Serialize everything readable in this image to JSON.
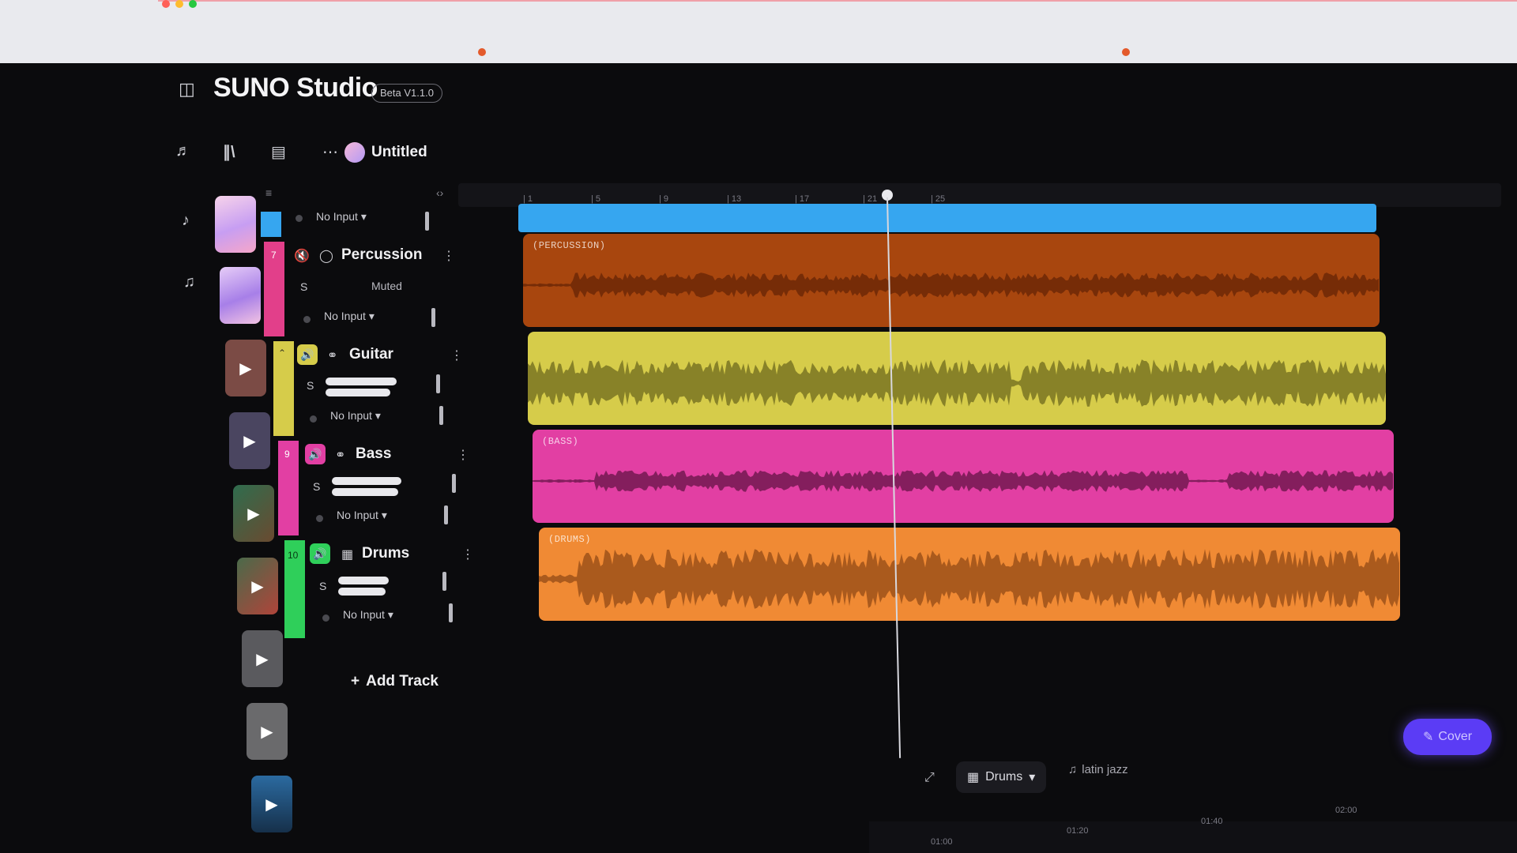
{
  "app": {
    "title": "SUNO Studio",
    "version_badge": "Beta V1.1.0",
    "project_name": "Untitled"
  },
  "colors": {
    "blue_track": "#36a6f0",
    "percussion": "#a8460e",
    "guitar": "#d6cc4a",
    "bass": "#e23fa3",
    "drums": "#f08a34",
    "accent_button": "#5b3cf5"
  },
  "tracks": [
    {
      "label": "",
      "input": "No Input"
    },
    {
      "number": "7",
      "label": "Percussion",
      "solo": "S",
      "status": "Muted",
      "input": "No Input",
      "icon": "percussion-icon"
    },
    {
      "label": "Guitar",
      "solo": "S",
      "input": "No Input",
      "icon": "guitar-icon"
    },
    {
      "number": "9",
      "label": "Bass",
      "solo": "S",
      "input": "No Input",
      "icon": "bass-icon"
    },
    {
      "number": "10",
      "label": "Drums",
      "solo": "S",
      "input": "No Input",
      "icon": "drums-icon"
    }
  ],
  "regions": {
    "percussion": "(PERCUSSION)",
    "bass": "(BASS)",
    "drums": "(DRUMS)"
  },
  "ruler": [
    "1",
    "5",
    "9",
    "13",
    "17",
    "21",
    "25"
  ],
  "add_track": "Add Track",
  "bottom": {
    "instrument_select": "Drums",
    "style_tag": "latin jazz",
    "cover_button": "Cover",
    "time_marks": [
      "01:00",
      "01:20",
      "01:40",
      "02:00"
    ]
  }
}
